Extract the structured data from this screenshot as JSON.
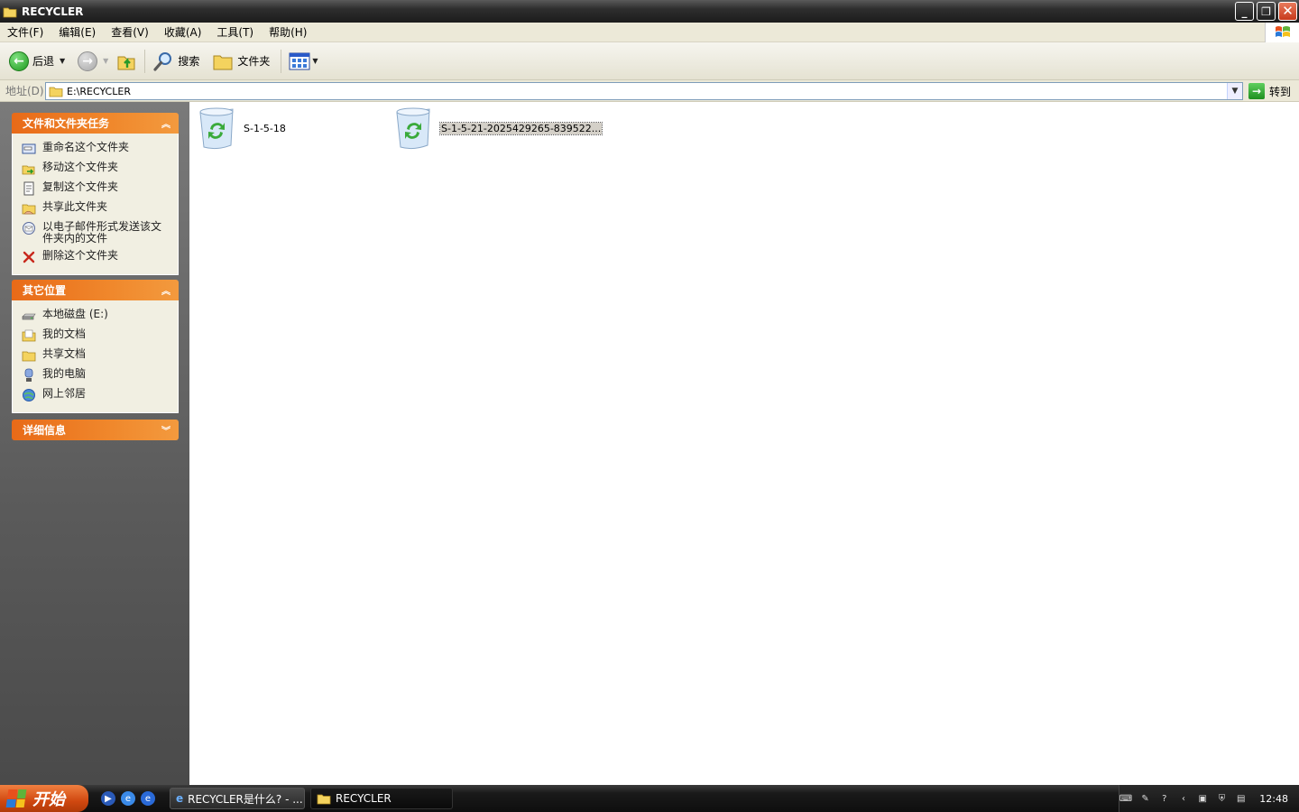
{
  "window": {
    "title": "RECYCLER",
    "buttons": {
      "minimize": "_",
      "restore": "❐",
      "close": "✕"
    }
  },
  "menu": [
    "文件(F)",
    "编辑(E)",
    "查看(V)",
    "收藏(A)",
    "工具(T)",
    "帮助(H)"
  ],
  "toolbar": {
    "back_label": "后退",
    "search_label": "搜索",
    "folders_label": "文件夹"
  },
  "address": {
    "label": "地址(D)",
    "value": "E:\\RECYCLER",
    "go_label": "转到"
  },
  "tasks_panel": {
    "title": "文件和文件夹任务",
    "items": [
      {
        "label": "重命名这个文件夹",
        "icon": "rename-icon"
      },
      {
        "label": "移动这个文件夹",
        "icon": "move-icon"
      },
      {
        "label": "复制这个文件夹",
        "icon": "copy-icon"
      },
      {
        "label": "共享此文件夹",
        "icon": "share-icon"
      },
      {
        "label": "以电子邮件形式发送该文件夹内的文件",
        "icon": "email-icon"
      },
      {
        "label": "删除这个文件夹",
        "icon": "delete-icon"
      }
    ]
  },
  "places_panel": {
    "title": "其它位置",
    "items": [
      {
        "label": "本地磁盘 (E:)",
        "icon": "drive-icon"
      },
      {
        "label": "我的文档",
        "icon": "documents-icon"
      },
      {
        "label": "共享文档",
        "icon": "folder-icon"
      },
      {
        "label": "我的电脑",
        "icon": "computer-icon"
      },
      {
        "label": "网上邻居",
        "icon": "network-icon"
      }
    ]
  },
  "details_panel": {
    "title": "详细信息"
  },
  "files": [
    {
      "name": "S-1-5-18",
      "selected": false
    },
    {
      "name": "S-1-5-21-2025429265-839522...",
      "selected": true
    }
  ],
  "taskbar": {
    "start_label": "开始",
    "buttons": [
      {
        "label": "RECYCLER是什么? - ...",
        "icon": "ie-icon",
        "active": false
      },
      {
        "label": "RECYCLER",
        "icon": "folder-icon",
        "active": true
      }
    ],
    "clock": "12:48"
  }
}
